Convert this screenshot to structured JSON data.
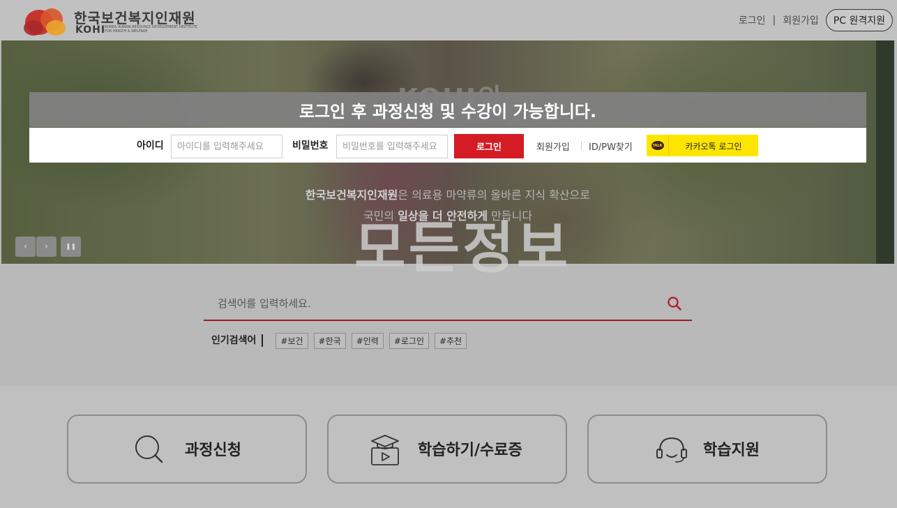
{
  "header": {
    "logo_ko": "한국보건복지인재원",
    "logo_en": "KOHI",
    "logo_sub": "KOREA HUMAN RESOURCE DEVELOPMENT INSTITUTE FOR HEALTH & WELFARE",
    "links": {
      "login": "로그인",
      "signup": "회원가입",
      "separator": "|"
    },
    "pc_remote": "PC 원격지원"
  },
  "hero": {
    "ghost_text": "KOHI의",
    "desc_line1_bold": "한국보건복지인재원",
    "desc_line1_rest": "은 의료용 마약류의 올바른 지식 확산으로",
    "desc_line2_pre": "국민의 ",
    "desc_line2_bold": "일상을 더 안전하게",
    "desc_line2_post": " 만듭니다",
    "controls": {
      "prev": "‹",
      "next": "›",
      "pause": "❚❚"
    },
    "big_ghost_text": "모든정보"
  },
  "login": {
    "title": "로그인 후 과정신청 및 수강이 가능합니다.",
    "id_label": "아이디",
    "id_placeholder": "아이디를 입력해주세요",
    "pw_label": "비밀번호",
    "pw_placeholder": "비밀번호를 입력해주세요",
    "login_button": "로그인",
    "signup_link": "회원가입",
    "find_link": "ID/PW찾기",
    "kakao_badge": "TALK",
    "kakao_button": "카카오톡 로그인"
  },
  "search": {
    "placeholder": "검색어를 입력하세요.",
    "popular_label": "인기검색어",
    "tags": [
      "#보건",
      "#한국",
      "#인력",
      "#로그인",
      "#추천"
    ]
  },
  "quick_menu": {
    "course_apply": "과정신청",
    "learning": "학습하기/수료증",
    "support": "학습지원"
  },
  "colors": {
    "accent_red": "#d31c24",
    "kakao_yellow": "#fee500",
    "overlay_gray": "#808080"
  }
}
